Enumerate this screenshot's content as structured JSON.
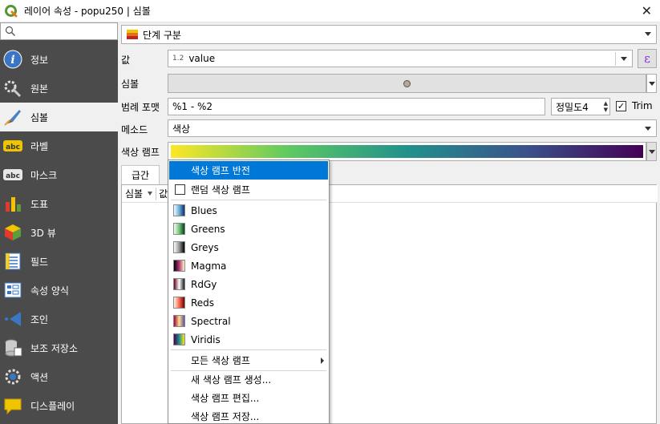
{
  "window": {
    "title": "레이어 속성 - popu250 | 심볼"
  },
  "sidebar": {
    "search_placeholder": "",
    "items": [
      {
        "label": "정보",
        "icon": "info-icon"
      },
      {
        "label": "원본",
        "icon": "source-wrench-icon"
      },
      {
        "label": "심볼",
        "icon": "symbology-brush-icon"
      },
      {
        "label": "라벨",
        "icon": "labels-abc-icon"
      },
      {
        "label": "마스크",
        "icon": "mask-abc-icon"
      },
      {
        "label": "도표",
        "icon": "diagram-icon"
      },
      {
        "label": "3D 뷰",
        "icon": "3d-cube-icon"
      },
      {
        "label": "필드",
        "icon": "fields-icon"
      },
      {
        "label": "속성 양식",
        "icon": "attributes-form-icon"
      },
      {
        "label": "조인",
        "icon": "join-icon"
      },
      {
        "label": "보조 저장소",
        "icon": "auxiliary-storage-icon"
      },
      {
        "label": "액션",
        "icon": "actions-gear-icon"
      },
      {
        "label": "디스플레이",
        "icon": "display-tooltip-icon"
      }
    ],
    "active_index": 2
  },
  "renderer": {
    "type_label": "단계 구분"
  },
  "value": {
    "label": "값",
    "type_badge": "1.2",
    "field": "value"
  },
  "symbol": {
    "label": "심볼"
  },
  "legend_format": {
    "label": "범례 포맷",
    "value": "%1 - %2",
    "precision_label": "정밀도4",
    "trim_label": "Trim",
    "trim_checked": true
  },
  "method": {
    "label": "메소드",
    "value": "색상"
  },
  "color_ramp": {
    "label": "색상 램프"
  },
  "tabs": [
    {
      "label": "급간"
    }
  ],
  "table": {
    "col_symbol": "심볼",
    "col_values_partial": "값"
  },
  "ramp_menu": {
    "invert": "색상 램프 반전",
    "random": "랜덤 색상 램프",
    "ramps": [
      {
        "name": "Blues",
        "colors": [
          "#f7fbff",
          "#6baed6",
          "#08306b"
        ]
      },
      {
        "name": "Greens",
        "colors": [
          "#f7fcf5",
          "#74c476",
          "#00441b"
        ]
      },
      {
        "name": "Greys",
        "colors": [
          "#ffffff",
          "#969696",
          "#000000"
        ]
      },
      {
        "name": "Magma",
        "colors": [
          "#000004",
          "#b63679",
          "#fcfdbf"
        ]
      },
      {
        "name": "RdGy",
        "colors": [
          "#67001f",
          "#ffffff",
          "#1a1a1a"
        ]
      },
      {
        "name": "Reds",
        "colors": [
          "#fff5f0",
          "#fb6a4a",
          "#67000d"
        ]
      },
      {
        "name": "Spectral",
        "colors": [
          "#9e0142",
          "#fee08b",
          "#5e4fa2"
        ]
      },
      {
        "name": "Viridis",
        "colors": [
          "#440154",
          "#21918c",
          "#fde725"
        ]
      }
    ],
    "all_ramps": "모든 색상 램프",
    "create": "새 색상 램프 생성...",
    "edit": "색상 램프 편집...",
    "save": "색상 램프 저장..."
  },
  "colors": {
    "sidebar_bg": "#4b4b4b",
    "highlight": "#0078d7"
  }
}
